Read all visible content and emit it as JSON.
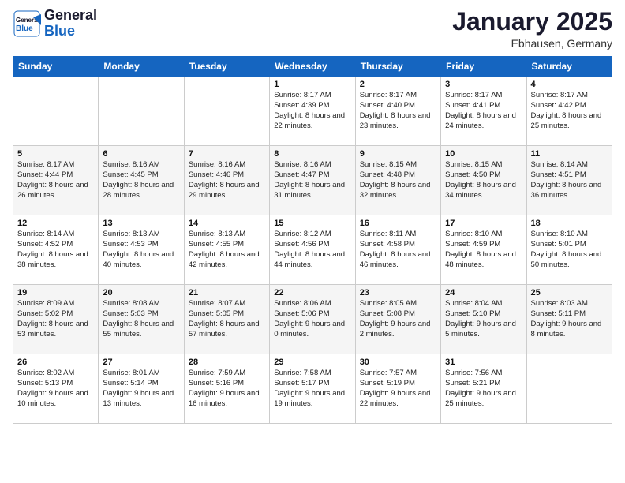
{
  "header": {
    "logo_line1": "General",
    "logo_line2": "Blue",
    "title": "January 2025",
    "subtitle": "Ebhausen, Germany"
  },
  "columns": [
    "Sunday",
    "Monday",
    "Tuesday",
    "Wednesday",
    "Thursday",
    "Friday",
    "Saturday"
  ],
  "weeks": [
    [
      {
        "day": "",
        "info": ""
      },
      {
        "day": "",
        "info": ""
      },
      {
        "day": "",
        "info": ""
      },
      {
        "day": "1",
        "info": "Sunrise: 8:17 AM\nSunset: 4:39 PM\nDaylight: 8 hours\nand 22 minutes."
      },
      {
        "day": "2",
        "info": "Sunrise: 8:17 AM\nSunset: 4:40 PM\nDaylight: 8 hours\nand 23 minutes."
      },
      {
        "day": "3",
        "info": "Sunrise: 8:17 AM\nSunset: 4:41 PM\nDaylight: 8 hours\nand 24 minutes."
      },
      {
        "day": "4",
        "info": "Sunrise: 8:17 AM\nSunset: 4:42 PM\nDaylight: 8 hours\nand 25 minutes."
      }
    ],
    [
      {
        "day": "5",
        "info": "Sunrise: 8:17 AM\nSunset: 4:44 PM\nDaylight: 8 hours\nand 26 minutes."
      },
      {
        "day": "6",
        "info": "Sunrise: 8:16 AM\nSunset: 4:45 PM\nDaylight: 8 hours\nand 28 minutes."
      },
      {
        "day": "7",
        "info": "Sunrise: 8:16 AM\nSunset: 4:46 PM\nDaylight: 8 hours\nand 29 minutes."
      },
      {
        "day": "8",
        "info": "Sunrise: 8:16 AM\nSunset: 4:47 PM\nDaylight: 8 hours\nand 31 minutes."
      },
      {
        "day": "9",
        "info": "Sunrise: 8:15 AM\nSunset: 4:48 PM\nDaylight: 8 hours\nand 32 minutes."
      },
      {
        "day": "10",
        "info": "Sunrise: 8:15 AM\nSunset: 4:50 PM\nDaylight: 8 hours\nand 34 minutes."
      },
      {
        "day": "11",
        "info": "Sunrise: 8:14 AM\nSunset: 4:51 PM\nDaylight: 8 hours\nand 36 minutes."
      }
    ],
    [
      {
        "day": "12",
        "info": "Sunrise: 8:14 AM\nSunset: 4:52 PM\nDaylight: 8 hours\nand 38 minutes."
      },
      {
        "day": "13",
        "info": "Sunrise: 8:13 AM\nSunset: 4:53 PM\nDaylight: 8 hours\nand 40 minutes."
      },
      {
        "day": "14",
        "info": "Sunrise: 8:13 AM\nSunset: 4:55 PM\nDaylight: 8 hours\nand 42 minutes."
      },
      {
        "day": "15",
        "info": "Sunrise: 8:12 AM\nSunset: 4:56 PM\nDaylight: 8 hours\nand 44 minutes."
      },
      {
        "day": "16",
        "info": "Sunrise: 8:11 AM\nSunset: 4:58 PM\nDaylight: 8 hours\nand 46 minutes."
      },
      {
        "day": "17",
        "info": "Sunrise: 8:10 AM\nSunset: 4:59 PM\nDaylight: 8 hours\nand 48 minutes."
      },
      {
        "day": "18",
        "info": "Sunrise: 8:10 AM\nSunset: 5:01 PM\nDaylight: 8 hours\nand 50 minutes."
      }
    ],
    [
      {
        "day": "19",
        "info": "Sunrise: 8:09 AM\nSunset: 5:02 PM\nDaylight: 8 hours\nand 53 minutes."
      },
      {
        "day": "20",
        "info": "Sunrise: 8:08 AM\nSunset: 5:03 PM\nDaylight: 8 hours\nand 55 minutes."
      },
      {
        "day": "21",
        "info": "Sunrise: 8:07 AM\nSunset: 5:05 PM\nDaylight: 8 hours\nand 57 minutes."
      },
      {
        "day": "22",
        "info": "Sunrise: 8:06 AM\nSunset: 5:06 PM\nDaylight: 9 hours\nand 0 minutes."
      },
      {
        "day": "23",
        "info": "Sunrise: 8:05 AM\nSunset: 5:08 PM\nDaylight: 9 hours\nand 2 minutes."
      },
      {
        "day": "24",
        "info": "Sunrise: 8:04 AM\nSunset: 5:10 PM\nDaylight: 9 hours\nand 5 minutes."
      },
      {
        "day": "25",
        "info": "Sunrise: 8:03 AM\nSunset: 5:11 PM\nDaylight: 9 hours\nand 8 minutes."
      }
    ],
    [
      {
        "day": "26",
        "info": "Sunrise: 8:02 AM\nSunset: 5:13 PM\nDaylight: 9 hours\nand 10 minutes."
      },
      {
        "day": "27",
        "info": "Sunrise: 8:01 AM\nSunset: 5:14 PM\nDaylight: 9 hours\nand 13 minutes."
      },
      {
        "day": "28",
        "info": "Sunrise: 7:59 AM\nSunset: 5:16 PM\nDaylight: 9 hours\nand 16 minutes."
      },
      {
        "day": "29",
        "info": "Sunrise: 7:58 AM\nSunset: 5:17 PM\nDaylight: 9 hours\nand 19 minutes."
      },
      {
        "day": "30",
        "info": "Sunrise: 7:57 AM\nSunset: 5:19 PM\nDaylight: 9 hours\nand 22 minutes."
      },
      {
        "day": "31",
        "info": "Sunrise: 7:56 AM\nSunset: 5:21 PM\nDaylight: 9 hours\nand 25 minutes."
      },
      {
        "day": "",
        "info": ""
      }
    ]
  ]
}
